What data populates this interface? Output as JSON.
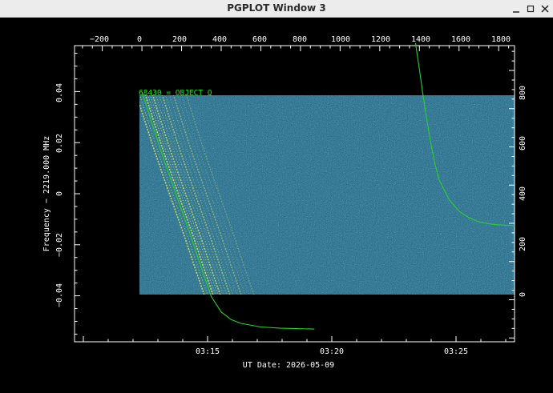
{
  "window": {
    "title": "PGPLOT Window 3",
    "controls": {
      "minimize_icon": "minimize-icon",
      "maximize_icon": "maximize-icon",
      "close_icon": "close-icon"
    }
  },
  "plot": {
    "colors": {
      "background": "#000000",
      "axes": "#ffffff",
      "curve": "#28d228",
      "annotation": "#20e020",
      "waterfall_base": "#2e6f8c"
    },
    "annotation": "68430 = OBJECT Q",
    "xlabel": "UT Date: 2026-05-09",
    "ylabel": "Frequency − 2219.000 MHz",
    "bottom_ticks": [
      "03:15",
      "03:20",
      "03:25"
    ],
    "top_ticks": [
      "−200",
      "0",
      "200",
      "400",
      "600",
      "800",
      "1000",
      "1200",
      "1400",
      "1600",
      "1800"
    ],
    "left_ticks": [
      "0.04",
      "0.02",
      "0",
      "−0.02",
      "−0.04"
    ],
    "right_ticks": [
      "800",
      "600",
      "400",
      "200",
      "0"
    ]
  },
  "chart_data": {
    "type": "heatmap",
    "title": "68430 = OBJECT Q",
    "xlabel": "UT Date: 2026-05-09",
    "ylabel": "Frequency − 2219.000 MHz",
    "top_axis": {
      "ticks": [
        -200,
        0,
        200,
        400,
        600,
        800,
        1000,
        1200,
        1400,
        1600,
        1800
      ],
      "range": [
        -340,
        1880
      ]
    },
    "right_axis": {
      "ticks": [
        0,
        200,
        400,
        600,
        800
      ],
      "range": [
        -420,
        1130
      ]
    },
    "left_axis": {
      "ticks": [
        0.04,
        0.02,
        0,
        -0.02,
        -0.04
      ],
      "range": [
        -0.058,
        0.058
      ]
    },
    "bottom_axis": {
      "ticks": [
        "03:15",
        "03:20",
        "03:25"
      ]
    },
    "waterfall_extent": {
      "top_axis": [
        0,
        1880
      ],
      "right_axis": [
        0,
        800
      ]
    },
    "series": [
      {
        "type": "line",
        "x": [
          0,
          50,
          100,
          150,
          200,
          250,
          300,
          350,
          400,
          450,
          500,
          600,
          700,
          800,
          870
        ],
        "y": [
          0.04,
          0.0278,
          0.0158,
          0.0046,
          -0.0063,
          -0.0174,
          -0.0291,
          -0.0403,
          -0.0463,
          -0.0493,
          -0.0508,
          -0.0522,
          -0.0527,
          -0.0529,
          -0.053
        ]
      },
      {
        "type": "line",
        "x": [
          1380,
          1400,
          1420,
          1440,
          1460,
          1480,
          1500,
          1550,
          1600,
          1650,
          1700,
          1750,
          1800,
          1880
        ],
        "y": [
          0.059,
          0.0487,
          0.0378,
          0.0278,
          0.0188,
          0.0112,
          0.0054,
          -0.0023,
          -0.0069,
          -0.0094,
          -0.011,
          -0.0118,
          -0.0122,
          -0.0125
        ]
      }
    ]
  }
}
